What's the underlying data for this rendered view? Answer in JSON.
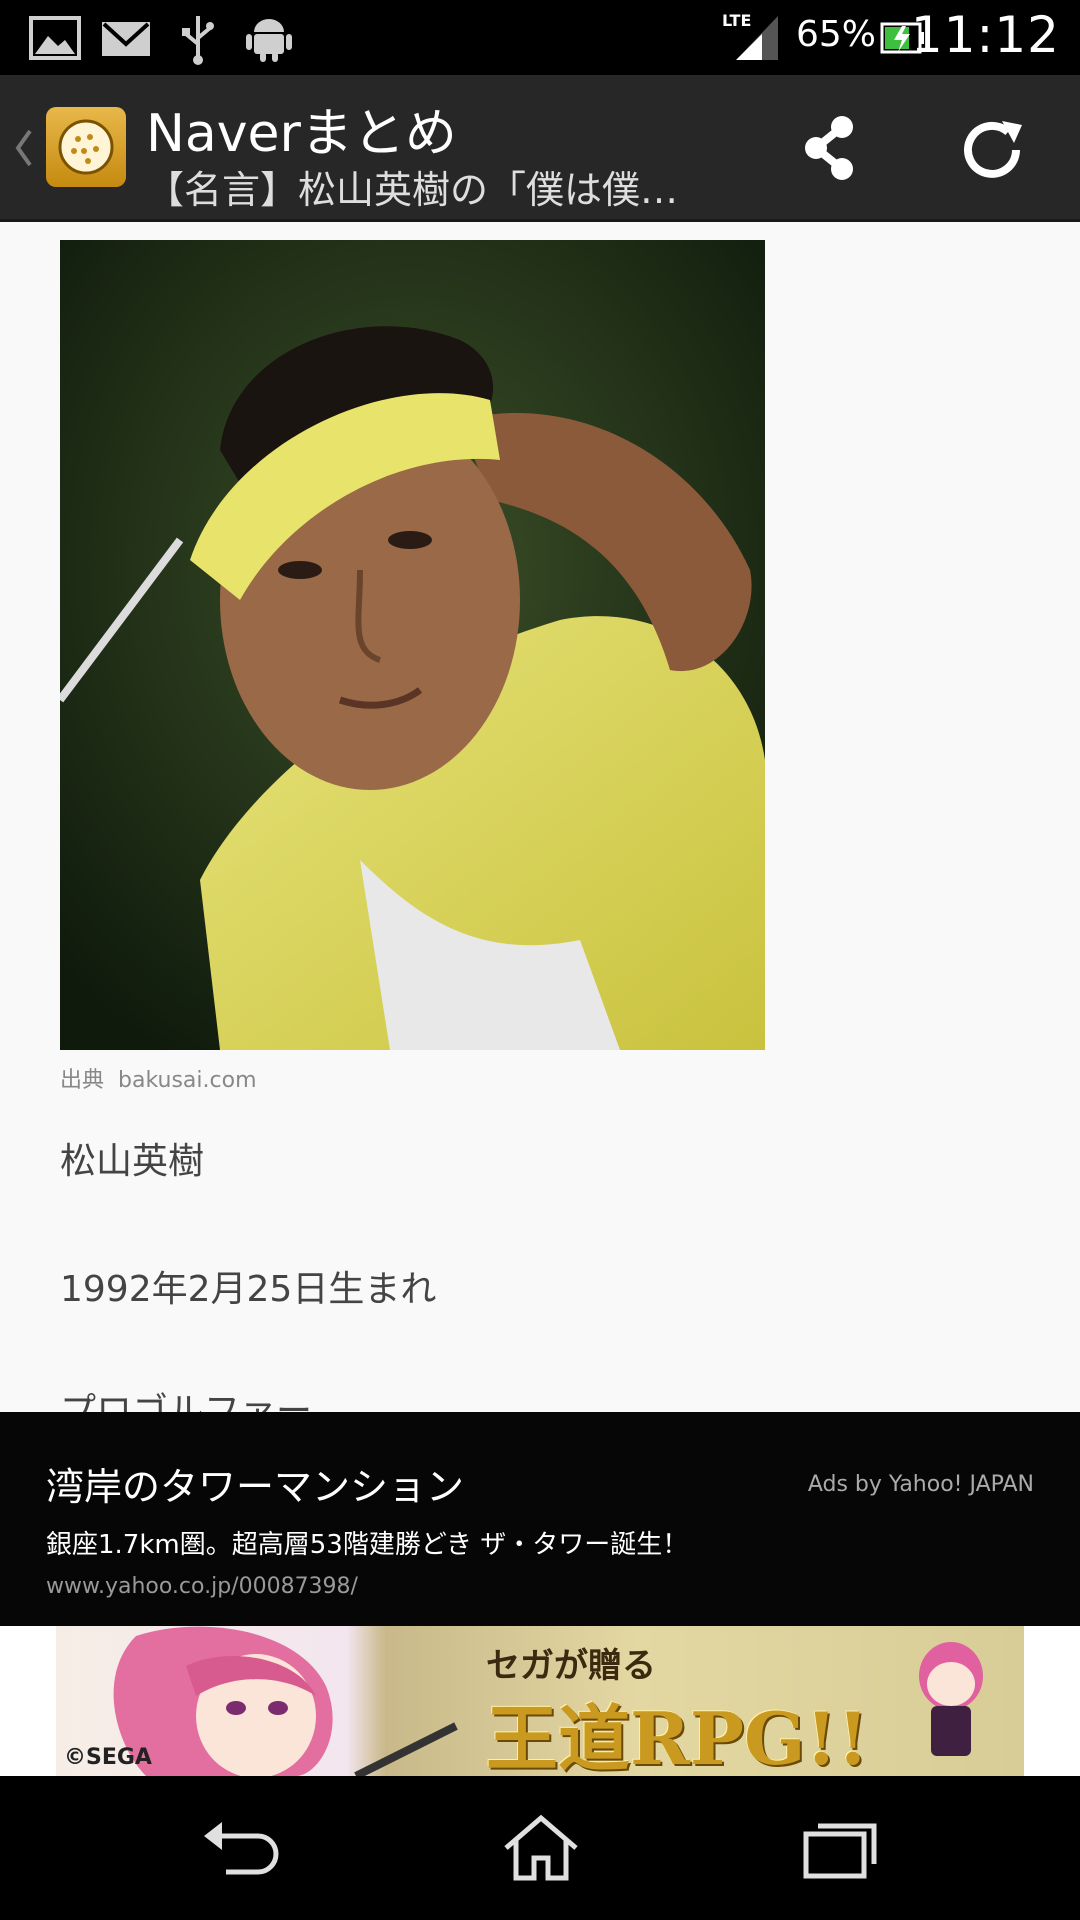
{
  "status_bar": {
    "network": "LTE",
    "battery_percent": "65%",
    "time": "11:12",
    "icons": [
      "gallery-icon",
      "gmail-icon",
      "usb-icon",
      "android-icon",
      "signal-icon",
      "battery-icon"
    ]
  },
  "action_bar": {
    "app_title": "Naverまとめ",
    "subtitle": "【名言】松山英樹の「僕は僕…",
    "icons": [
      "back-chevron-icon",
      "app-icon",
      "share-icon",
      "refresh-icon"
    ]
  },
  "article": {
    "caption_label": "出典",
    "caption_source": "bakusai.com",
    "name": "松山英樹",
    "birth": "1992年2月25日生まれ",
    "profession": "プロゴルファー"
  },
  "ad": {
    "title": "湾岸のタワーマンション",
    "attribution": "Ads by Yahoo! JAPAN",
    "description": "銀座1.7km圏。超高層53階建勝どき ザ・タワー誕生！",
    "url": "www.yahoo.co.jp/00087398/"
  },
  "banner": {
    "copyright": "©SEGA",
    "line1": "セガが贈る",
    "line2": "王道RPG!!"
  },
  "nav_bar": {
    "icons": [
      "back-icon",
      "home-icon",
      "recent-apps-icon"
    ]
  }
}
